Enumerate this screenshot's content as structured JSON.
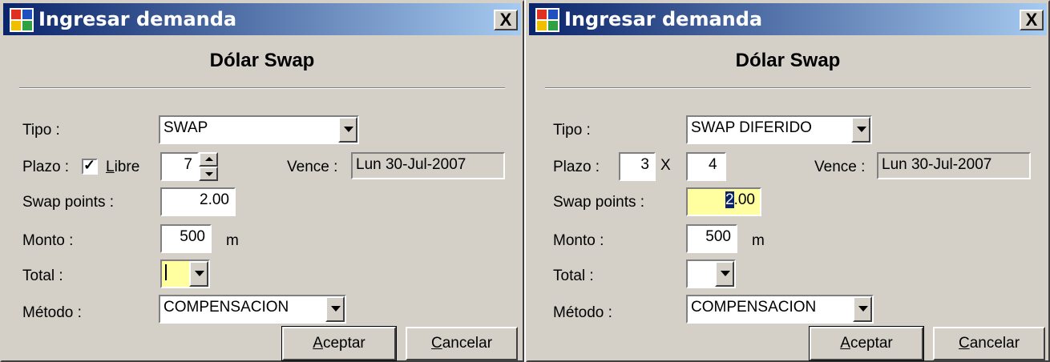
{
  "window1": {
    "title": "Ingresar demanda",
    "close_label": "X",
    "heading": "Dólar Swap",
    "tipo_label": "Tipo :",
    "tipo_value": "SWAP",
    "plazo_label": "Plazo :",
    "libre_checked": true,
    "libre_label": "Libre",
    "plazo_value": "7",
    "vence_label": "Vence :",
    "vence_value": "Lun  30-Jul-2007",
    "swap_points_label": "Swap points :",
    "swap_points_value": "2.00",
    "monto_label": "Monto :",
    "monto_value": "500",
    "monto_unit": "m",
    "total_label": "Total :",
    "total_value": "",
    "metodo_label": "Método :",
    "metodo_value": "COMPENSACION",
    "accept_button": "Aceptar",
    "cancel_button": "Cancelar"
  },
  "window2": {
    "title": "Ingresar demanda",
    "close_label": "X",
    "heading": "Dólar Swap",
    "tipo_label": "Tipo :",
    "tipo_value": "SWAP DIFERIDO",
    "plazo_label": "Plazo :",
    "plazo_from": "3",
    "plazo_separator": "X",
    "plazo_to": "4",
    "vence_label": "Vence :",
    "vence_value": "Lun  30-Jul-2007",
    "swap_points_label": "Swap points :",
    "swap_points_selected": "2",
    "swap_points_rest": ".00",
    "monto_label": "Monto :",
    "monto_value": "500",
    "monto_unit": "m",
    "total_label": "Total :",
    "total_value": "",
    "metodo_label": "Método :",
    "metodo_value": "COMPENSACION",
    "accept_button": "Aceptar",
    "cancel_button": "Cancelar"
  },
  "colors": {
    "titlebar_start": "#0a246a",
    "titlebar_end": "#a6caf0",
    "dialog_face": "#d4d0c8",
    "focus_field": "#ffffa0"
  },
  "icons": [
    "app-logo-icon",
    "close-icon",
    "dropdown-arrow-icon",
    "spin-up-icon",
    "spin-down-icon",
    "checkmark-icon"
  ]
}
